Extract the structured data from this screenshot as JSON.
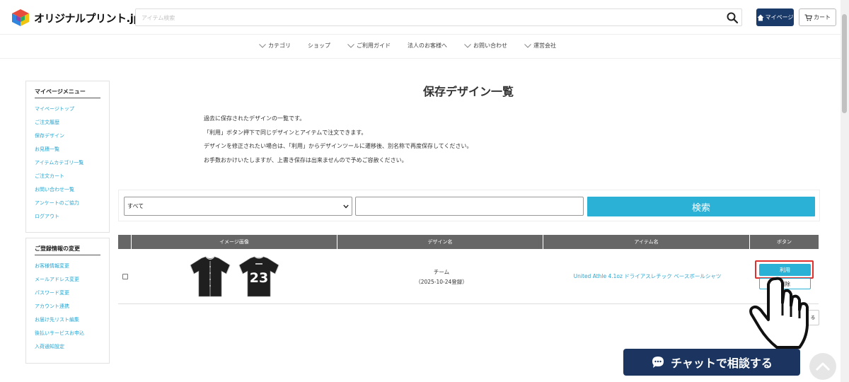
{
  "header": {
    "logo_text": "オリジナルプリント.jp",
    "search_placeholder": "アイテム検索",
    "mypage_label": "マイページ",
    "cart_label": "カート"
  },
  "nav": {
    "items": [
      {
        "label": "カテゴリ",
        "has_chevron": true
      },
      {
        "label": "ショップ",
        "has_chevron": false
      },
      {
        "label": "ご利用ガイド",
        "has_chevron": true
      },
      {
        "label": "法人のお客様へ",
        "has_chevron": false
      },
      {
        "label": "お問い合わせ",
        "has_chevron": true
      },
      {
        "label": "運営会社",
        "has_chevron": true
      }
    ]
  },
  "sidebar": {
    "menu_title": "マイページメニュー",
    "menu_items": [
      "マイページトップ",
      "ご注文履歴",
      "保存デザイン",
      "お見積一覧",
      "アイテムカテゴリ一覧",
      "ご注文カート",
      "お問い合わせ一覧",
      "アンケートのご協力",
      "ログアウト"
    ],
    "account_title": "ご登録情報の変更",
    "account_items": [
      "お客様情報変更",
      "メールアドレス変更",
      "パスワード変更",
      "アカウント連携",
      "お届け先リスト編集",
      "後払いサービスお申込",
      "入荷通知設定"
    ]
  },
  "main": {
    "title": "保存デザイン一覧",
    "intro": [
      "過去に保存されたデザインの一覧です。",
      "「利用」ボタン押下で同じデザインとアイテムで注文できます。",
      "デザインを修正されたい場合は、「利用」からデザインツールに遷移後、別名称で再度保存してください。",
      "お手数おかけいたしますが、上書き保存は出来ませんので予めご容赦ください。"
    ],
    "filter": {
      "select_value": "すべて",
      "input_value": "",
      "search_label": "検索"
    },
    "table": {
      "headers": [
        "イメージ画像",
        "デザイン名",
        "アイテム名",
        "ボタン"
      ],
      "rows": [
        {
          "design_name": "チーム",
          "design_date": "（2025-10-24登録）",
          "item_name": "United Athle 4.1oz ドライアスレチック ベースボールシャツ",
          "back_number": "23",
          "use_label": "利用",
          "delete_label": "削除"
        }
      ]
    },
    "small_button_label": "る"
  },
  "chat": {
    "label": "チャットで相談する"
  },
  "colors": {
    "accent": "#2bb0d6",
    "navy": "#1b3560",
    "highlight": "#e0302e",
    "table_header": "#666666"
  }
}
